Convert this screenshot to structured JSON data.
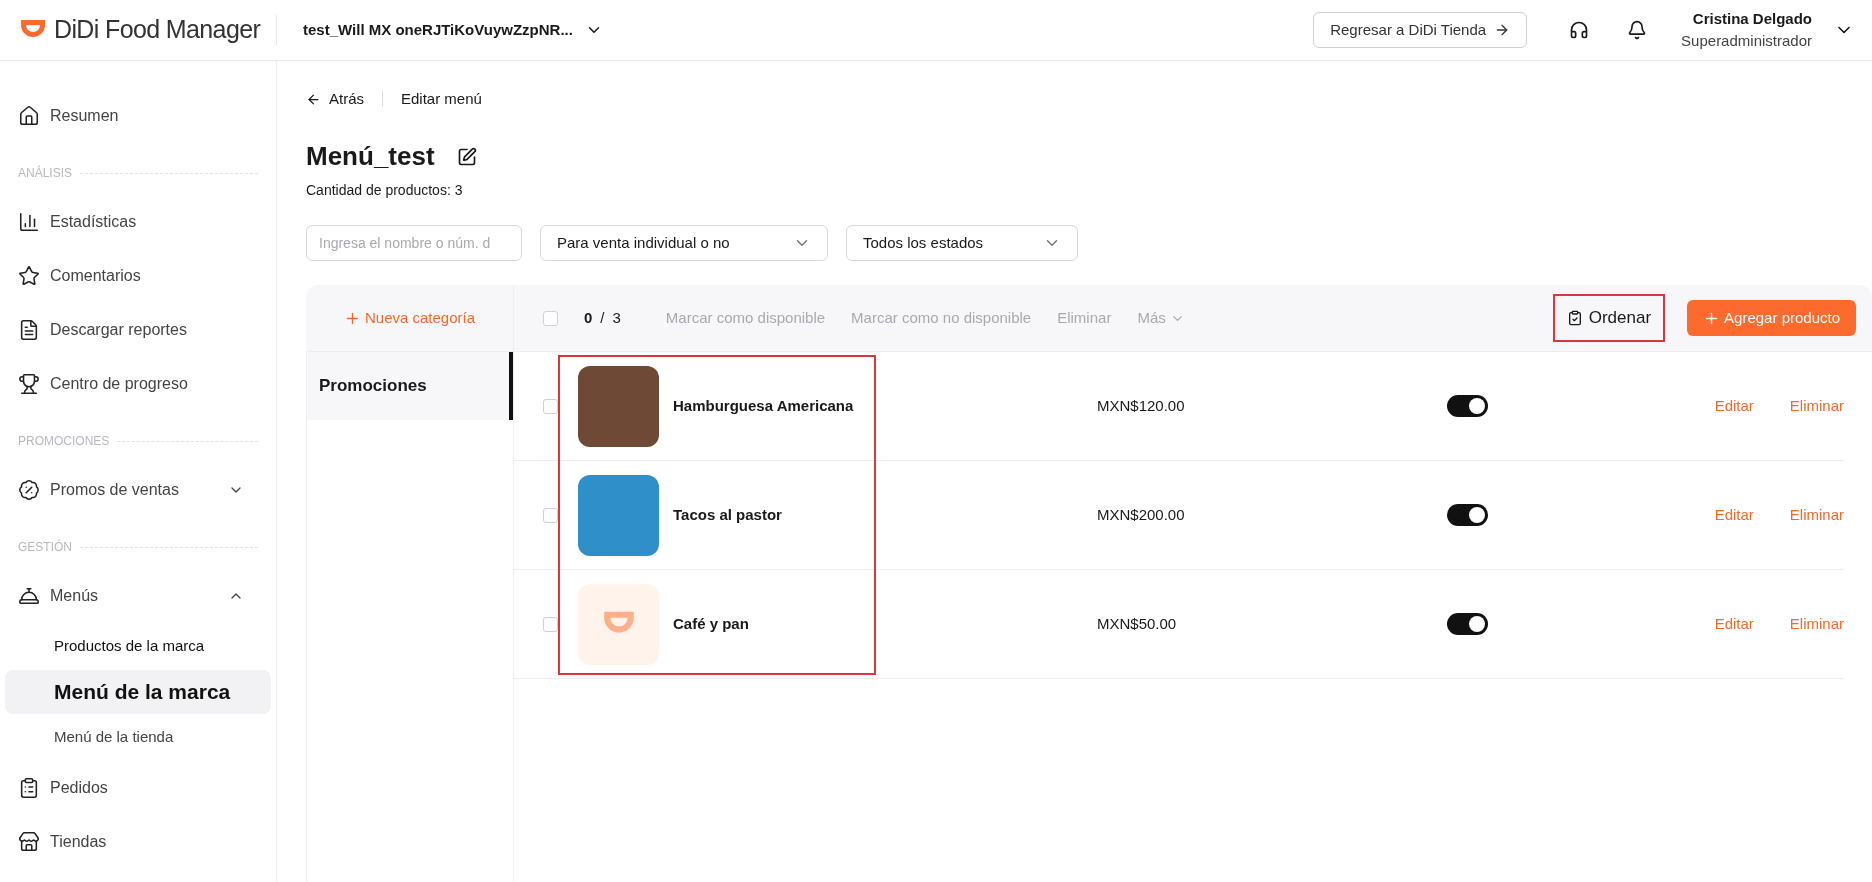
{
  "header": {
    "logo_text": "DiDi Food Manager",
    "store_selector": "test_Will MX oneRJTiKoVuywZzpNR...",
    "return_button": "Regresar a DiDi Tienda",
    "user": {
      "name": "Cristina Delgado",
      "role": "Superadministrador"
    }
  },
  "sidebar": {
    "items": [
      {
        "kind": "item",
        "label": "Resumen",
        "selected": false
      },
      {
        "kind": "section",
        "label": "ANÁLISIS"
      },
      {
        "kind": "item",
        "label": "Estadísticas",
        "selected": false
      },
      {
        "kind": "item",
        "label": "Comentarios",
        "selected": false
      },
      {
        "kind": "item",
        "label": "Descargar reportes",
        "selected": false
      },
      {
        "kind": "item",
        "label": "Centro de progreso",
        "selected": false
      },
      {
        "kind": "section",
        "label": "PROMOCIONES"
      },
      {
        "kind": "group",
        "label": "Promos de ventas",
        "expanded": false
      },
      {
        "kind": "section",
        "label": "GESTIÓN"
      },
      {
        "kind": "group",
        "label": "Menús",
        "expanded": true,
        "children": [
          {
            "label": "Productos de la marca",
            "selected": false
          },
          {
            "label": "Menú de la marca",
            "selected": true
          },
          {
            "label": "Menú de la tienda",
            "selected": false
          }
        ]
      },
      {
        "kind": "item",
        "label": "Pedidos",
        "selected": false
      },
      {
        "kind": "item",
        "label": "Tiendas",
        "selected": false
      }
    ]
  },
  "breadcrumb": {
    "back": "Atrás",
    "current": "Editar menú"
  },
  "title": "Menú_test",
  "product_count": "Cantidad de productos: 3",
  "filters": {
    "search_placeholder": "Ingresa el nombre o núm. d",
    "selects": [
      "Para venta individual o no",
      "Todos los estados"
    ]
  },
  "categories": {
    "new_button": "Nueva categoría",
    "items": [
      {
        "label": "Promociones",
        "selected": true
      }
    ]
  },
  "toolbar": {
    "select_all_checked": false,
    "selected_count": "0",
    "separator": "/",
    "total": "3",
    "actions": [
      "Marcar como disponible",
      "Marcar como no disponible",
      "Eliminar"
    ],
    "more": "Más",
    "sort_button": {
      "label": "Ordenar",
      "highlighted": true
    },
    "add_button": "Agregar producto"
  },
  "products_highlighted": true,
  "products": [
    {
      "kind": "photo",
      "name": "Hamburguesa Americana",
      "price": "MXN$120.00",
      "checked": false,
      "on": true,
      "edit": "Editar",
      "delete": "Eliminar"
    },
    {
      "kind": "photo",
      "name": "Tacos al pastor",
      "price": "MXN$200.00",
      "checked": false,
      "on": true,
      "edit": "Editar",
      "delete": "Eliminar"
    },
    {
      "kind": "logo",
      "name": "Café y pan",
      "price": "MXN$50.00",
      "checked": false,
      "on": true,
      "edit": "Editar",
      "delete": "Eliminar"
    }
  ]
}
